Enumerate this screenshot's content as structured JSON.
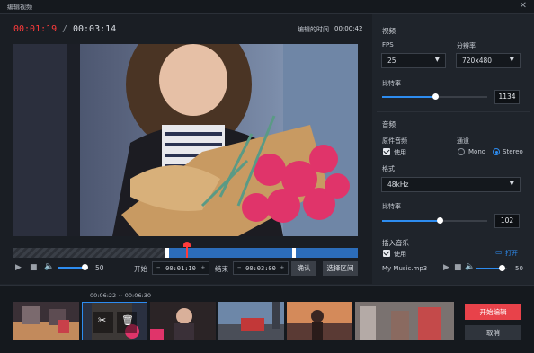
{
  "window": {
    "title": "编辑视频",
    "close_glyph": "✕"
  },
  "player": {
    "current_time": "00:01:19",
    "separator": "/",
    "total_time": "00:03:14",
    "edited_time_label": "编辑的时间",
    "edited_time_value": "00:00:42",
    "volume_value": "50",
    "timeline_marker_fraction": 0.5,
    "selection_start_fraction": 0.44,
    "selection_end_fraction": 0.82
  },
  "trim": {
    "start_label": "开始",
    "start_value": "00:01:10",
    "end_label": "结束",
    "end_value": "00:03:00",
    "minus": "−",
    "plus": "+",
    "confirm_label": "确认",
    "select_range_label": "选择区间"
  },
  "video_settings": {
    "section_label": "视频",
    "fps_label": "FPS",
    "fps_value": "25",
    "resolution_label": "分辨率",
    "resolution_value": "720x480",
    "bitrate_label": "比特率",
    "bitrate_value": "1134",
    "bitrate_fraction": 0.5
  },
  "audio_settings": {
    "section_label": "音频",
    "original_audio_label": "原件音频",
    "use_label": "使用",
    "channel_label": "通道",
    "mono_label": "Mono",
    "stereo_label": "Stereo",
    "format_label": "格式",
    "format_value": "48kHz",
    "bitrate_label": "比特率",
    "bitrate_value": "102",
    "bitrate_fraction": 0.55
  },
  "music": {
    "section_label": "插入音乐",
    "use_label": "使用",
    "open_label": "打开",
    "file_name": "My Music.mp3",
    "volume_value": "50"
  },
  "clips": {
    "selected_range": "00:06:22 ~ 00:06:30"
  },
  "actions": {
    "start_edit_label": "开始编辑",
    "cancel_label": "取消"
  },
  "colors": {
    "accent_blue": "#2d8cf0",
    "accent_red": "#ff3b3b",
    "primary_button": "#e8424a"
  }
}
